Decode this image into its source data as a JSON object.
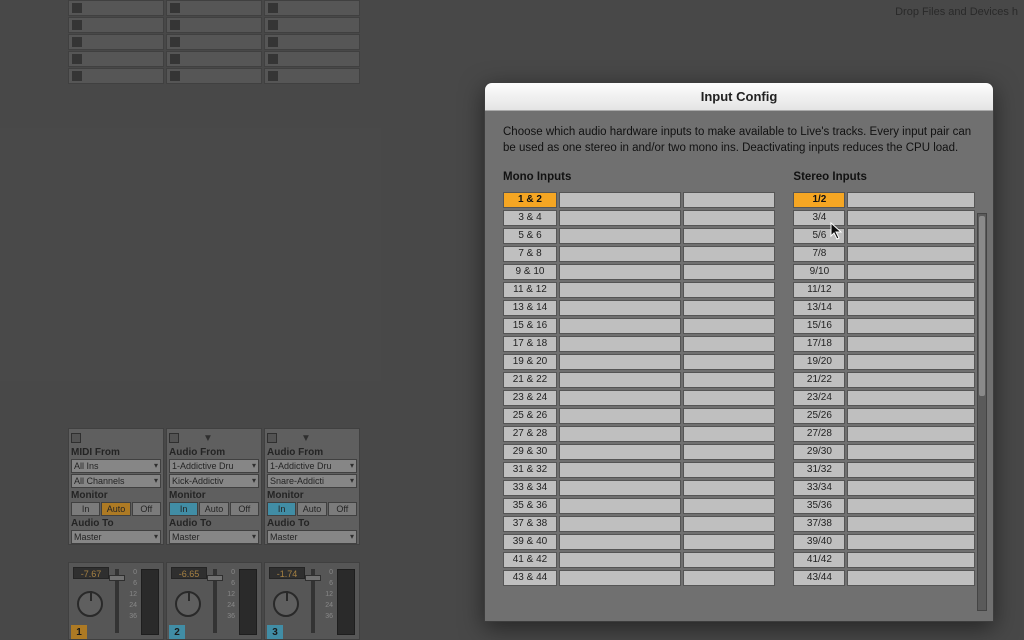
{
  "drop_hint": "Drop Files and Devices h",
  "modal": {
    "title": "Input Config",
    "description": "Choose which audio hardware inputs to make available to Live's tracks. Every input pair can be used as one stereo in and/or two mono ins.  Deactivating inputs reduces the CPU load.",
    "mono_header": "Mono Inputs",
    "stereo_header": "Stereo Inputs",
    "mono": [
      {
        "label": "1 & 2",
        "active": true
      },
      {
        "label": "3 & 4"
      },
      {
        "label": "5 & 6"
      },
      {
        "label": "7 & 8"
      },
      {
        "label": "9 & 10"
      },
      {
        "label": "11 & 12"
      },
      {
        "label": "13 & 14"
      },
      {
        "label": "15 & 16"
      },
      {
        "label": "17 & 18"
      },
      {
        "label": "19 & 20"
      },
      {
        "label": "21 & 22"
      },
      {
        "label": "23 & 24"
      },
      {
        "label": "25 & 26"
      },
      {
        "label": "27 & 28"
      },
      {
        "label": "29 & 30"
      },
      {
        "label": "31 & 32"
      },
      {
        "label": "33 & 34"
      },
      {
        "label": "35 & 36"
      },
      {
        "label": "37 & 38"
      },
      {
        "label": "39 & 40"
      },
      {
        "label": "41 & 42"
      },
      {
        "label": "43 & 44"
      }
    ],
    "stereo": [
      {
        "label": "1/2",
        "active": true
      },
      {
        "label": "3/4"
      },
      {
        "label": "5/6"
      },
      {
        "label": "7/8"
      },
      {
        "label": "9/10"
      },
      {
        "label": "11/12"
      },
      {
        "label": "13/14"
      },
      {
        "label": "15/16"
      },
      {
        "label": "17/18"
      },
      {
        "label": "19/20"
      },
      {
        "label": "21/22"
      },
      {
        "label": "23/24"
      },
      {
        "label": "25/26"
      },
      {
        "label": "27/28"
      },
      {
        "label": "29/30"
      },
      {
        "label": "31/32"
      },
      {
        "label": "33/34"
      },
      {
        "label": "35/36"
      },
      {
        "label": "37/38"
      },
      {
        "label": "39/40"
      },
      {
        "label": "41/42"
      },
      {
        "label": "43/44"
      }
    ]
  },
  "tracks": [
    {
      "from_label": "MIDI From",
      "from_value": "All Ins",
      "sub_value": "All Channels",
      "monitor_label": "Monitor",
      "mon_active": "Auto",
      "mon_style": "orange",
      "to_label": "Audio To",
      "to_value": "Master",
      "vol": "-7.67",
      "chan": "1",
      "chan_class": "c1"
    },
    {
      "from_label": "Audio From",
      "from_value": "1-Addictive Dru",
      "sub_value": "Kick-Addictiv",
      "monitor_label": "Monitor",
      "mon_active": "In",
      "mon_style": "blue",
      "to_label": "Audio To",
      "to_value": "Master",
      "vol": "-6.65",
      "chan": "2",
      "chan_class": "c2"
    },
    {
      "from_label": "Audio From",
      "from_value": "1-Addictive Dru",
      "sub_value": "Snare-Addicti",
      "monitor_label": "Monitor",
      "mon_active": "In",
      "mon_style": "blue",
      "to_label": "Audio To",
      "to_value": "Master",
      "vol": "-1.74",
      "chan": "3",
      "chan_class": "c3"
    }
  ],
  "mon_buttons": [
    "In",
    "Auto",
    "Off"
  ],
  "scale": [
    "0",
    "6",
    "12",
    "24",
    "36"
  ]
}
